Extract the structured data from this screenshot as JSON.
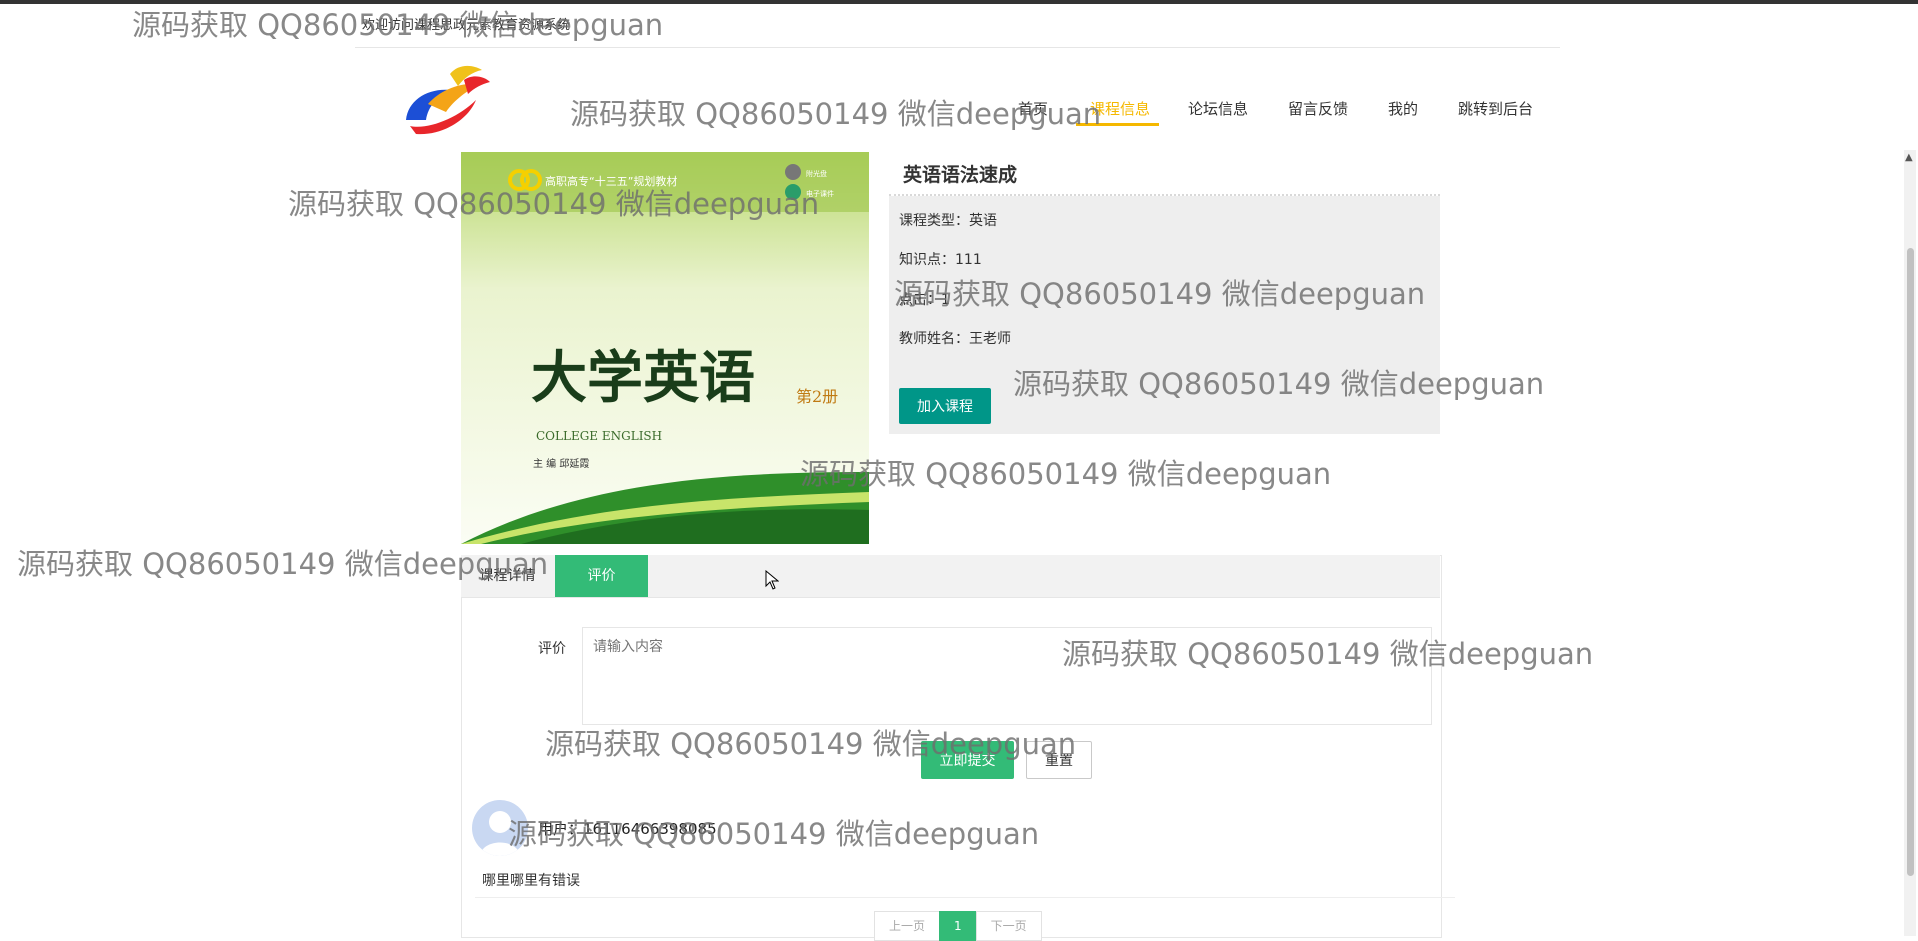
{
  "header": {
    "welcome": "欢迎访问课程思政元素教育资源系统",
    "nav": [
      {
        "label": "首页",
        "active": false
      },
      {
        "label": "课程信息",
        "active": true
      },
      {
        "label": "论坛信息",
        "active": false
      },
      {
        "label": "留言反馈",
        "active": false
      },
      {
        "label": "我的",
        "active": false
      },
      {
        "label": "跳转到后台",
        "active": false
      }
    ],
    "accent": "#f5b800"
  },
  "course": {
    "title": "英语语法速成",
    "type": "课程类型：英语",
    "knowledge": "知识点：111",
    "clicks": "点击：1",
    "teacher": "教师姓名：王老师",
    "join_label": "加入课程",
    "cover": {
      "series": "高职高专“十三五”规划教材",
      "badge_top": "附光盘",
      "badge_bottom": "电子课件",
      "title": "大学英语",
      "volume": "第2册",
      "english": "COLLEGE ENGLISH",
      "editor": "主 编  邱延霞"
    }
  },
  "tabs": [
    {
      "label": "课程详情",
      "active": false
    },
    {
      "label": "评价",
      "active": true
    }
  ],
  "review_form": {
    "label": "评价",
    "placeholder": "请输入内容",
    "submit_label": "立即提交",
    "reset_label": "重置"
  },
  "comments": [
    {
      "user": "用户：16116466398085",
      "content": "哪里哪里有错误"
    }
  ],
  "pagination": {
    "prev": "上一页",
    "current": "1",
    "next": "下一页"
  },
  "watermark": "源码获取 QQ86050149 微信deepguan",
  "colors": {
    "green": "#33bb77",
    "teal": "#009688",
    "panel": "#eeeeee"
  }
}
